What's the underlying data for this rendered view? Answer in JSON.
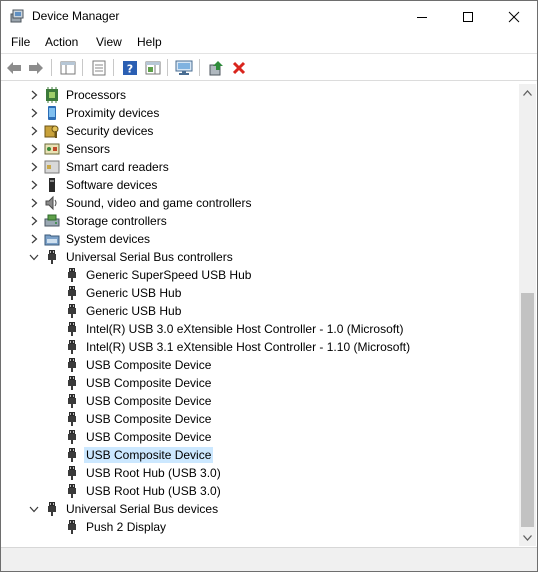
{
  "window": {
    "title": "Device Manager"
  },
  "menu": [
    "File",
    "Action",
    "View",
    "Help"
  ],
  "toolbar": {
    "icons": [
      "back-icon",
      "forward-icon",
      "show-hide-console-tree-icon",
      "properties-icon",
      "help-icon",
      "action-pane-icon",
      "scan-hardware-icon",
      "update-driver-icon",
      "uninstall-device-icon"
    ],
    "colors": {
      "uninstall": "#d9251d",
      "update": "#2e8b3a"
    }
  },
  "tree": [
    {
      "label": "Processors",
      "level": 0,
      "expander": "collapsed",
      "icon": "processor-icon"
    },
    {
      "label": "Proximity devices",
      "level": 0,
      "expander": "collapsed",
      "icon": "proximity-icon"
    },
    {
      "label": "Security devices",
      "level": 0,
      "expander": "collapsed",
      "icon": "security-key-icon"
    },
    {
      "label": "Sensors",
      "level": 0,
      "expander": "collapsed",
      "icon": "sensor-icon"
    },
    {
      "label": "Smart card readers",
      "level": 0,
      "expander": "collapsed",
      "icon": "smart-card-icon"
    },
    {
      "label": "Software devices",
      "level": 0,
      "expander": "collapsed",
      "icon": "software-device-icon"
    },
    {
      "label": "Sound, video and game controllers",
      "level": 0,
      "expander": "collapsed",
      "icon": "speaker-icon"
    },
    {
      "label": "Storage controllers",
      "level": 0,
      "expander": "collapsed",
      "icon": "storage-icon"
    },
    {
      "label": "System devices",
      "level": 0,
      "expander": "collapsed",
      "icon": "system-folder-icon"
    },
    {
      "label": "Universal Serial Bus controllers",
      "level": 0,
      "expander": "expanded",
      "icon": "usb-icon"
    },
    {
      "label": "Generic SuperSpeed USB Hub",
      "level": 1,
      "icon": "usb-icon"
    },
    {
      "label": "Generic USB Hub",
      "level": 1,
      "icon": "usb-icon"
    },
    {
      "label": "Generic USB Hub",
      "level": 1,
      "icon": "usb-icon"
    },
    {
      "label": "Intel(R) USB 3.0 eXtensible Host Controller - 1.0 (Microsoft)",
      "level": 1,
      "icon": "usb-icon"
    },
    {
      "label": "Intel(R) USB 3.1 eXtensible Host Controller - 1.10 (Microsoft)",
      "level": 1,
      "icon": "usb-icon"
    },
    {
      "label": "USB Composite Device",
      "level": 1,
      "icon": "usb-icon"
    },
    {
      "label": "USB Composite Device",
      "level": 1,
      "icon": "usb-icon"
    },
    {
      "label": "USB Composite Device",
      "level": 1,
      "icon": "usb-icon"
    },
    {
      "label": "USB Composite Device",
      "level": 1,
      "icon": "usb-icon"
    },
    {
      "label": "USB Composite Device",
      "level": 1,
      "icon": "usb-icon"
    },
    {
      "label": "USB Composite Device",
      "level": 1,
      "icon": "usb-icon",
      "selected": true
    },
    {
      "label": "USB Root Hub (USB 3.0)",
      "level": 1,
      "icon": "usb-icon"
    },
    {
      "label": "USB Root Hub (USB 3.0)",
      "level": 1,
      "icon": "usb-icon"
    },
    {
      "label": "Universal Serial Bus devices",
      "level": 0,
      "expander": "expanded",
      "icon": "usb-icon"
    },
    {
      "label": "Push 2 Display",
      "level": 1,
      "icon": "usb-icon"
    }
  ],
  "selection_color": "#cce8ff"
}
